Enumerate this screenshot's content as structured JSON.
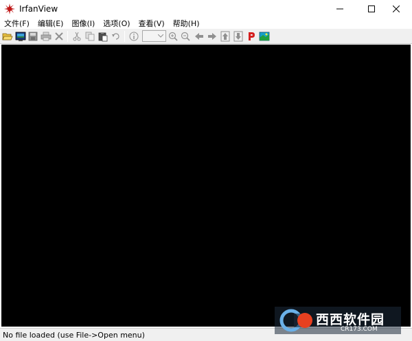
{
  "window": {
    "title": "IrfanView"
  },
  "menu": {
    "items": [
      {
        "label": "文件(F)"
      },
      {
        "label": "编辑(E)"
      },
      {
        "label": "图像(I)"
      },
      {
        "label": "选项(O)"
      },
      {
        "label": "查看(V)"
      },
      {
        "label": "帮助(H)"
      }
    ]
  },
  "toolbar": {
    "zoom_value": "",
    "icons": [
      "open-folder-icon",
      "thumbnails-icon",
      "save-icon",
      "print-icon",
      "delete-icon",
      "cut-icon",
      "copy-icon",
      "paste-icon",
      "undo-icon",
      "info-icon",
      "zoom-in-icon",
      "zoom-out-icon",
      "previous-arrow-icon",
      "next-arrow-icon",
      "first-file-icon",
      "last-file-icon",
      "paint-icon",
      "screenshot-icon"
    ]
  },
  "status": {
    "text": "No file loaded (use File->Open menu)"
  },
  "watermark": {
    "brand": "西西软件园",
    "site": "CR173.COM"
  },
  "colors": {
    "canvas": "#000000",
    "toolbar": "#f0f0f0",
    "accent_red": "#d42020"
  }
}
